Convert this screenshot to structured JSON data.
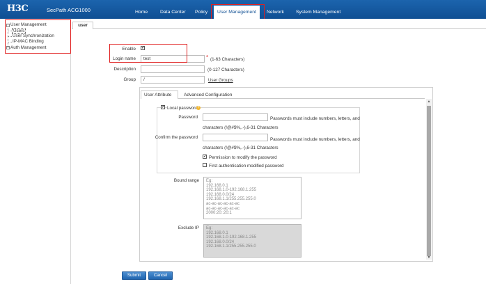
{
  "header": {
    "logo": "H3C",
    "product": "SecPath ACG1000",
    "nav": [
      "Home",
      "Data Center",
      "Policy",
      "User Management",
      "Network",
      "System Management"
    ],
    "active_nav": "User Management"
  },
  "sidebar": {
    "root": "User Management",
    "children": [
      "Users",
      "User Synchronization",
      "IP-MAC Binding"
    ],
    "second_root": "Auth Management"
  },
  "tab": "user",
  "form": {
    "enable_label": "Enable",
    "login_label": "Login name",
    "login_value": "test",
    "login_hint": "(1-63 Characters)",
    "description_label": "Description",
    "description_hint": "(0-127 Characters)",
    "group_label": "Group",
    "group_value": "/",
    "group_link": "User Groups"
  },
  "subtabs": [
    "User Attribute",
    "Advanced Configuration"
  ],
  "password": {
    "local_label": "Local password",
    "password_label": "Password",
    "confirm_label": "Confirm the password",
    "hint_line1": "Passwords must include numbers, letters, and",
    "hint_line2": "characters (!@#$%,.-),6-31 Characters",
    "permission_label": "Permission to modify the password",
    "first_auth_label": "First authentication modified password"
  },
  "bound_range": {
    "label": "Bound range",
    "placeholder": "Eg:\n192.168.0.1\n192.168.1.0-192.168.1.255\n192.168.0.0/24\n192.168.1.1/255.255.255.0\nac-ac-ac-ac-ac-ac\nac-ac-ac-ac-ac-ac\n2000:20::20:1"
  },
  "exclude_ip": {
    "label": "Exclude IP",
    "placeholder": "Eg:\n192.168.0.1\n192.168.1.0-192.168.1.255\n192.168.0.0/24\n192.168.1.1/255.255.255.0"
  },
  "buttons": {
    "submit": "Submit",
    "cancel": "Cancel"
  },
  "colors": {
    "header_blue": "#1666b0",
    "highlight_red": "#e02020",
    "button_blue": "#2f78c4"
  }
}
